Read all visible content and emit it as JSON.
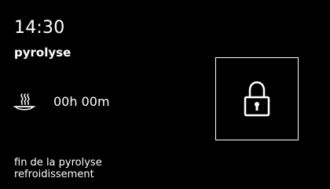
{
  "header": {
    "time": "14:30",
    "mode": "pyrolyse"
  },
  "timer": {
    "icon": "steam-dish-icon",
    "remaining": "00h 00m"
  },
  "status": {
    "line1": "fin de la pyrolyse",
    "line2": "refroidissement"
  },
  "lock": {
    "icon": "padlock-icon",
    "locked": true
  },
  "colors": {
    "background": "#000000",
    "foreground": "#ffffff"
  }
}
